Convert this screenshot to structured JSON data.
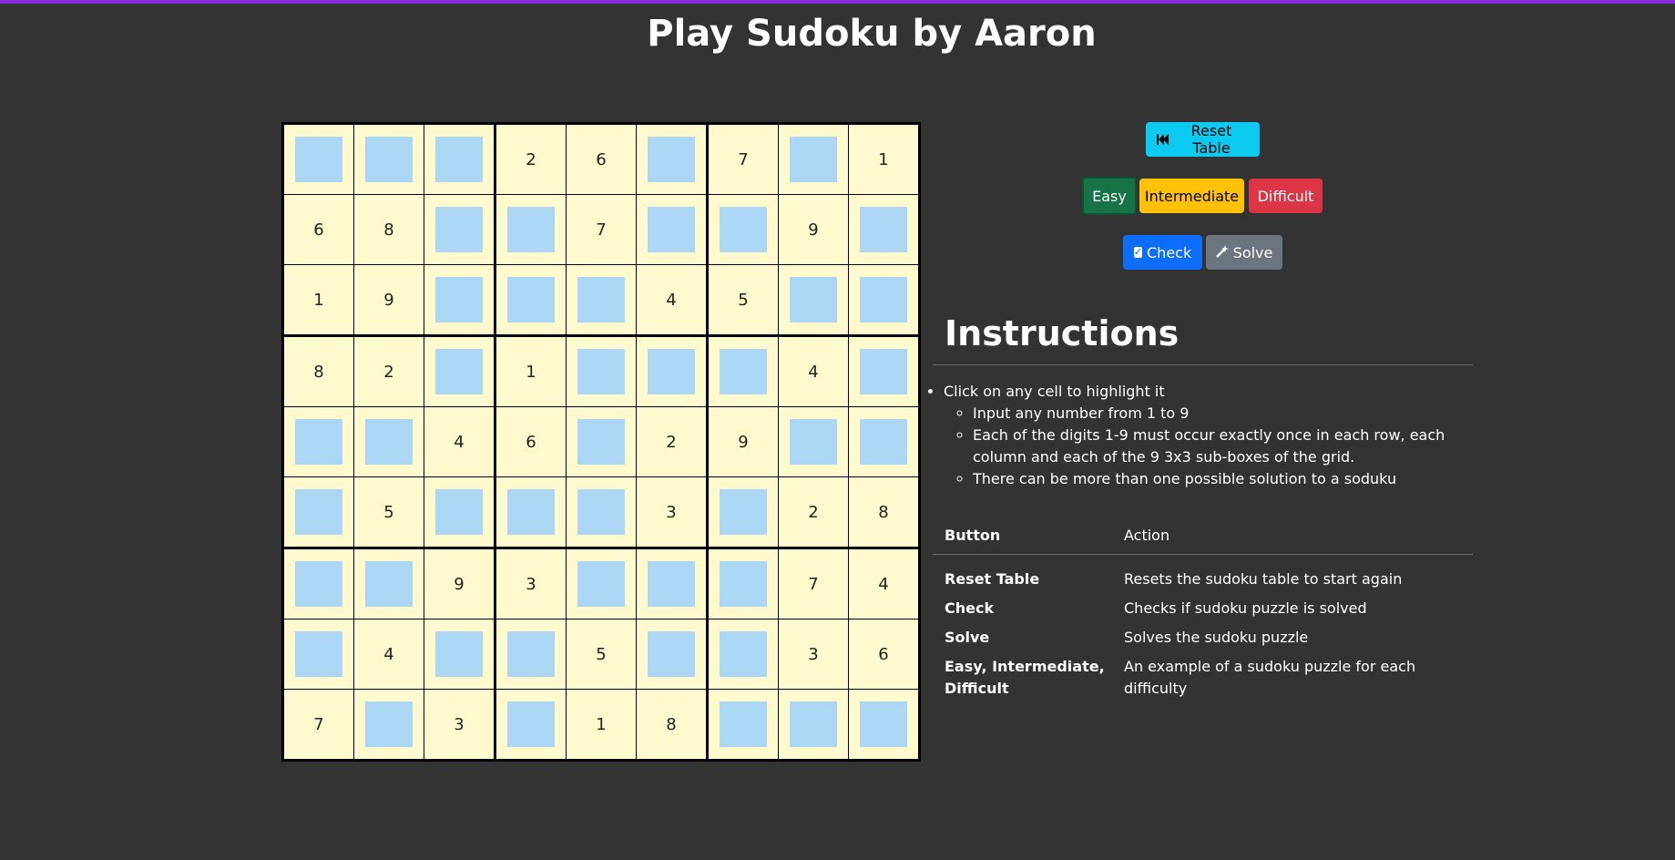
{
  "title": "Play Sudoku by Aaron",
  "board": [
    [
      "",
      "",
      "",
      "2",
      "6",
      "",
      "7",
      "",
      "1"
    ],
    [
      "6",
      "8",
      "",
      "",
      "7",
      "",
      "",
      "9",
      ""
    ],
    [
      "1",
      "9",
      "",
      "",
      "",
      "4",
      "5",
      "",
      ""
    ],
    [
      "8",
      "2",
      "",
      "1",
      "",
      "",
      "",
      "4",
      ""
    ],
    [
      "",
      "",
      "4",
      "6",
      "",
      "2",
      "9",
      "",
      ""
    ],
    [
      "",
      "5",
      "",
      "",
      "",
      "3",
      "",
      "2",
      "8"
    ],
    [
      "",
      "",
      "9",
      "3",
      "",
      "",
      "",
      "7",
      "4"
    ],
    [
      "",
      "4",
      "",
      "",
      "5",
      "",
      "",
      "3",
      "6"
    ],
    [
      "7",
      "",
      "3",
      "",
      "1",
      "8",
      "",
      "",
      ""
    ]
  ],
  "buttons": {
    "reset": "Reset Table",
    "easy": "Easy",
    "intermediate": "Intermediate",
    "difficult": "Difficult",
    "check": "Check",
    "solve": "Solve"
  },
  "instructions": {
    "heading": "Instructions",
    "main_item": "Click on any cell to highlight it",
    "sub_items": [
      "Input any number from 1 to 9",
      "Each of the digits 1-9 must occur exactly once in each row, each column and each of the 9 3x3 sub-boxes of the grid.",
      "There can be more than one possible solution to a soduku"
    ]
  },
  "action_table": {
    "header": {
      "button": "Button",
      "action": "Action"
    },
    "rows": [
      {
        "button": "Reset Table",
        "action": "Resets the sudoku table to start again"
      },
      {
        "button": "Check",
        "action": "Checks if sudoku puzzle is solved"
      },
      {
        "button": "Solve",
        "action": "Solves the sudoku puzzle"
      },
      {
        "button": "Easy, Intermediate, Difficult",
        "action": "An example of a sudoku puzzle for each difficulty"
      }
    ]
  },
  "colors": {
    "background": "#333333",
    "accent_bar": "#8a2be2",
    "cell_bg": "#fffacd",
    "empty_cell": "#abd7f5"
  },
  "icons": {
    "reset": "backward-step-icon",
    "check": "checkbox-icon",
    "solve": "magic-wand-icon"
  }
}
